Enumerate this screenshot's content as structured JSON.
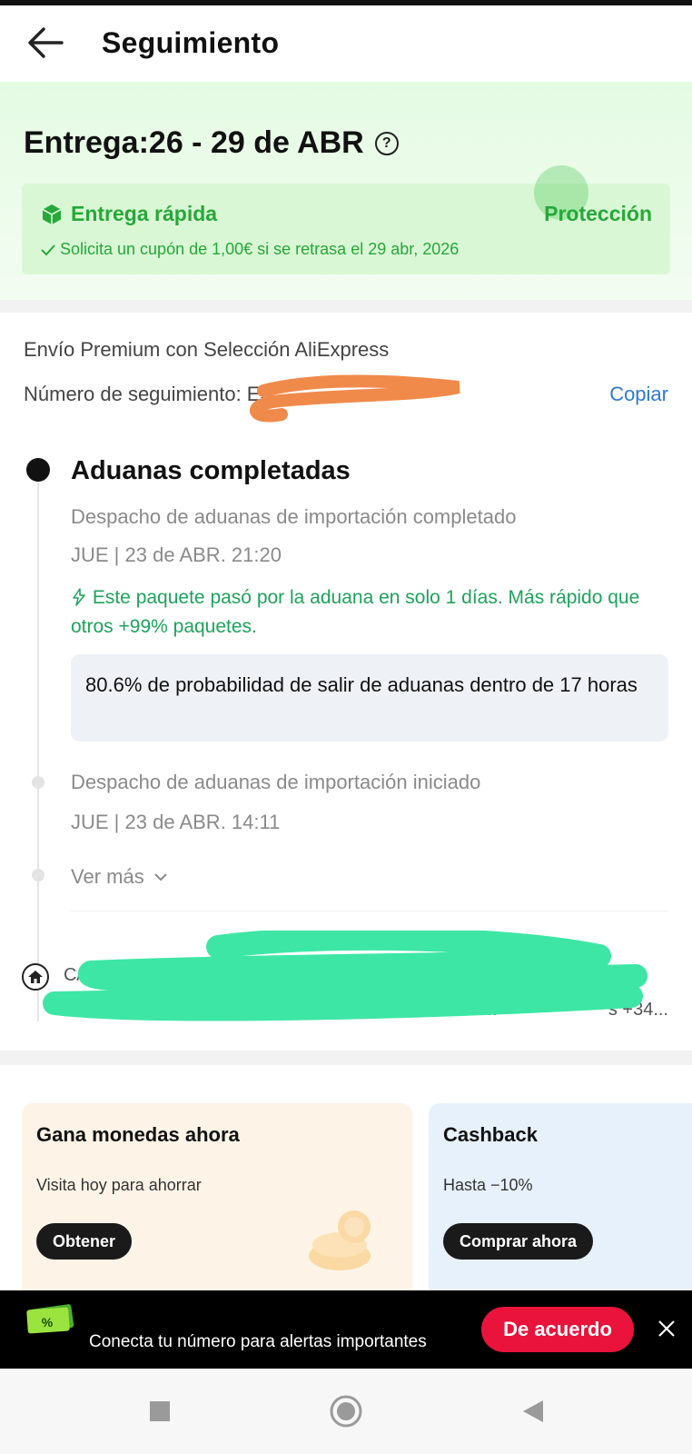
{
  "header": {
    "title": "Seguimiento"
  },
  "delivery": {
    "title": "Entrega:26 - 29 de ABR",
    "help_icon_label": "?",
    "fast_label": "Entrega rápida",
    "protection_label": "Protección",
    "coupon_text": "Solicita un cupón de 1,00€ si se retrasa el 29 abr, 2026"
  },
  "shipping": {
    "method": "Envío Premium con Selección AliExpress",
    "tracking_label": "Número de seguimiento: ES",
    "copy_label": "Copiar"
  },
  "timeline": {
    "status_title": "Aduanas completadas",
    "events": [
      {
        "description": "Despacho de aduanas de importación completado",
        "time": "JUE | 23 de ABR. 21:20"
      },
      {
        "description": "Despacho de aduanas de importación iniciado",
        "time": "JUE | 23 de ABR. 14:11"
      }
    ],
    "fast_note": "Este paquete pasó por la aduana en solo 1 días. Más rápido que otros +99% paquetes.",
    "probability_text": "80.6% de probabilidad de salir de aduanas dentro de 17 horas",
    "see_more": "Ver más"
  },
  "address": {
    "line1": "C/ ... O San Pe...",
    "line2": "Re... ***************s +34..."
  },
  "promos": [
    {
      "title": "Gana monedas ahora",
      "subtitle": "Visita hoy para ahorrar",
      "button": "Obtener"
    },
    {
      "title": "Cashback",
      "subtitle": "Hasta −10%",
      "button": "Comprar ahora"
    }
  ],
  "consent": {
    "text": "Conecta tu número para alertas importantes",
    "icon_label": "%",
    "agree_button": "De acuerdo"
  },
  "colors": {
    "green": "#26a83a",
    "teal_green": "#1ea35b",
    "link_blue": "#2e7ad0",
    "agree_red": "#e9133b"
  }
}
